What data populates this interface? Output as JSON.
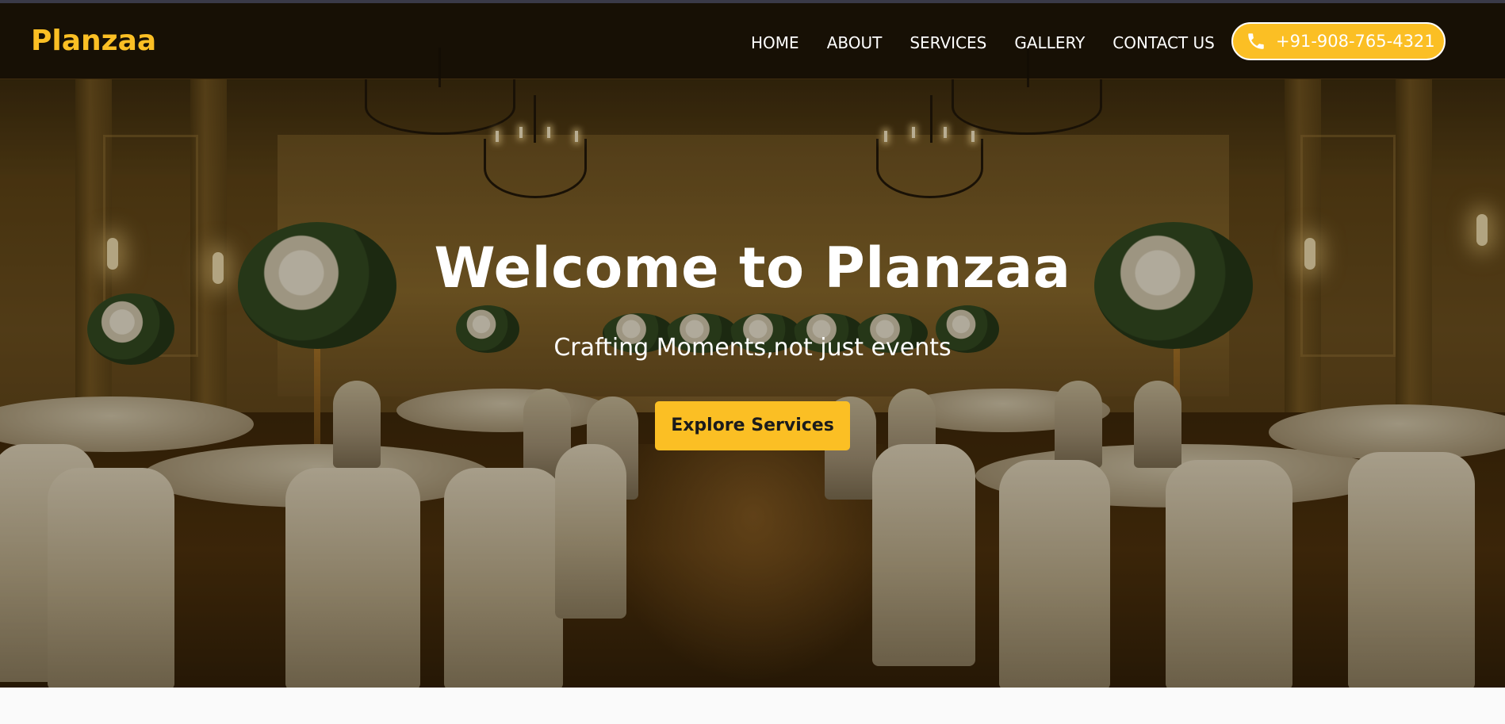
{
  "brand": {
    "name": "Planzaa",
    "accent_color": "#fbbf24"
  },
  "nav": {
    "links": [
      {
        "label": "HOME"
      },
      {
        "label": "ABOUT"
      },
      {
        "label": "SERVICES"
      },
      {
        "label": "GALLERY"
      },
      {
        "label": "CONTACT US"
      }
    ],
    "phone": {
      "icon": "phone-icon",
      "label": "+91-908-765-4321"
    }
  },
  "hero": {
    "background": "banquet-hall-image",
    "title": "Welcome to Planzaa",
    "subtitle": "Crafting Moments,not just events",
    "cta_label": "Explore Services"
  }
}
